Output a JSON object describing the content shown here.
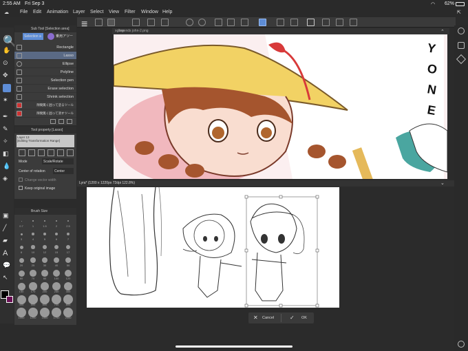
{
  "status": {
    "time": "2:55 AM",
    "date": "Fri Sep 3",
    "battery": "62%"
  },
  "menu": [
    "File",
    "Edit",
    "Animation",
    "Layer",
    "Select",
    "View",
    "Filter",
    "Window",
    "Help"
  ],
  "subtool": {
    "title": "Sub Tool [Selection area]",
    "tab_label": "Selection a",
    "tab_label2": "乗用アツー",
    "items": [
      "Rectangle",
      "Lasso",
      "Ellipse",
      "Polyline",
      "Selection pen",
      "Erase selection",
      "Shrink selection",
      "隙間無く囲って塗るツール",
      "隙間無く囲って消すツール"
    ]
  },
  "toolprop": {
    "title": "Tool property [Lasso]",
    "editing": "[Editing Transformation Range]",
    "layer": "Layer 13",
    "mode_label": "Mode",
    "mode_value": "Scale/Rotate",
    "center_label": "Center of rotation",
    "center_value": "Center",
    "change_vector": "Change vector width",
    "keep_original": "Keep original image"
  },
  "brush": {
    "title": "Brush Size",
    "sizes": [
      "0.7",
      "1",
      "1.5",
      "2",
      "2.5",
      "3",
      "4",
      "5",
      "6",
      "7",
      "8",
      "10",
      "12",
      "15",
      "17",
      "20",
      "25",
      "30",
      "40",
      "50",
      "60",
      "70",
      "80",
      "100",
      "120",
      "150",
      "170",
      "200",
      "250",
      "300",
      "400",
      "500",
      "600",
      "700",
      "800",
      "1000",
      "1200",
      "1500",
      "1700",
      "2000"
    ]
  },
  "tabs": {
    "doc1": "legends john-2.png",
    "doc1_prefix": "xgbse",
    "doc2": "Lyra* (1200 x 1220px 72dpi 122.8%)"
  },
  "buttons": {
    "cancel": "Cancel",
    "ok": "OK"
  },
  "colors": {
    "accent": "#5e8dd6",
    "fg": "#000000",
    "bg": "#6a0f55"
  }
}
